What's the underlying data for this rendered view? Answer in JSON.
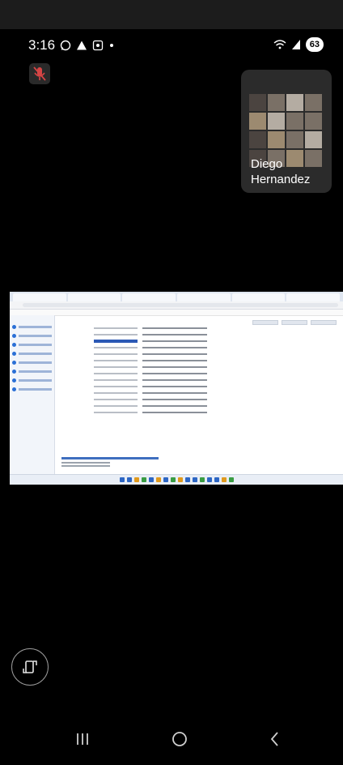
{
  "status_bar": {
    "time": "3:16",
    "left_icons": [
      "whatsapp-icon",
      "warning-icon",
      "screen-record-icon",
      "notification-dot"
    ],
    "right_icons": [
      "wifi-icon",
      "signal-icon"
    ],
    "battery": "63"
  },
  "call": {
    "mic_state": "muted",
    "participant": {
      "name": "Diego Hernandez"
    }
  },
  "shared_screen": {
    "description_hidden": true
  },
  "colors": {
    "background": "#000000",
    "tile": "#2b2b2b",
    "mic_off": "#d64545",
    "nav_icons": "#cfcfcf"
  },
  "navigation": {
    "buttons": [
      "recent-apps",
      "home",
      "back"
    ]
  }
}
